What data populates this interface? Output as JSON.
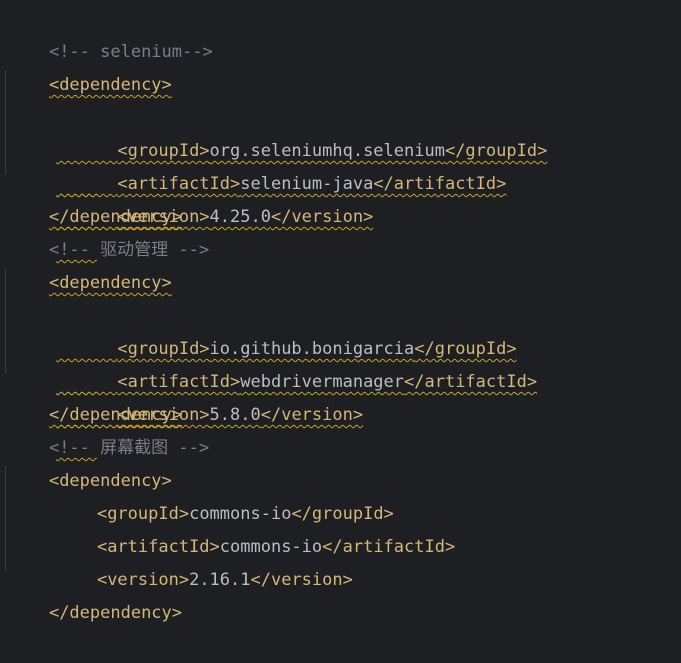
{
  "lines": {
    "l1": "<!-- selenium-->",
    "l2": "<dependency>",
    "l3a": "<groupId>",
    "l3b": "org.seleniumhq.selenium",
    "l3c": "</groupId>",
    "l4a": "<artifactId>",
    "l4b": "selenium-java",
    "l4c": "</artifactId>",
    "l5a": "<version>",
    "l5b": "4.25.0",
    "l5c": "</version>",
    "l6": "</dependency>",
    "l7": "<!-- 驱动管理 -->",
    "l8": "<dependency>",
    "l9a": "<groupId>",
    "l9b": "io.github.bonigarcia",
    "l9c": "</groupId>",
    "l10a": "<artifactId>",
    "l10b": "webdrivermanager",
    "l10c": "</artifactId>",
    "l11a": "<version>",
    "l11b": "5.8.0",
    "l11c": "</version>",
    "l12": "</dependency>",
    "l13": "<!-- 屏幕截图 -->",
    "l14": "<dependency>",
    "l15a": "<groupId>",
    "l15b": "commons-io",
    "l15c": "</groupId>",
    "l16a": "<artifactId>",
    "l16b": "commons-io",
    "l16c": "</artifactId>",
    "l17a": "<version>",
    "l17b": "2.16.1",
    "l17c": "</version>",
    "l18": "</dependency>"
  },
  "colors": {
    "background": "#1e1f22",
    "tag": "#d5b778",
    "text": "#bcbec4",
    "comment": "#7a7e85",
    "warning_underline": "#c9a227"
  }
}
